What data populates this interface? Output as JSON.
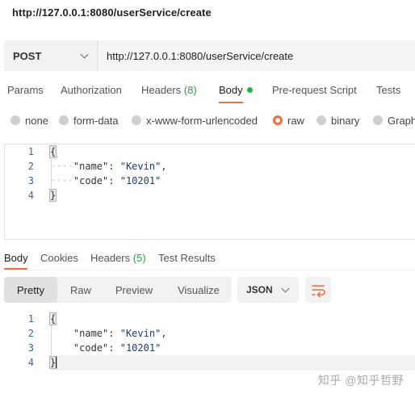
{
  "request": {
    "title": "http://127.0.0.1:8080/userService/create",
    "method": "POST",
    "url": "http://127.0.0.1:8080/userService/create"
  },
  "request_tabs": [
    {
      "label": "Params"
    },
    {
      "label": "Authorization"
    },
    {
      "label": "Headers",
      "badge": "(8)"
    },
    {
      "label": "Body",
      "active": true
    },
    {
      "label": "Pre-request Script"
    },
    {
      "label": "Tests"
    }
  ],
  "body_types": [
    {
      "label": "none"
    },
    {
      "label": "form-data"
    },
    {
      "label": "x-www-form-urlencoded"
    },
    {
      "label": "raw",
      "selected": true
    },
    {
      "label": "binary"
    },
    {
      "label": "Graph"
    }
  ],
  "request_body": {
    "line_numbers": [
      "1",
      "2",
      "3",
      "4"
    ],
    "open_brace": "{",
    "close_brace": "}",
    "fields": [
      {
        "key": "\"name\"",
        "value": "\"Kevin\"",
        "trail": ","
      },
      {
        "key": "\"code\"",
        "value": "\"10201\"",
        "trail": ""
      }
    ]
  },
  "response_tabs": [
    {
      "label": "Body",
      "active": true
    },
    {
      "label": "Cookies"
    },
    {
      "label": "Headers",
      "badge": "(5)"
    },
    {
      "label": "Test Results"
    }
  ],
  "view_modes": [
    {
      "label": "Pretty",
      "active": true
    },
    {
      "label": "Raw"
    },
    {
      "label": "Preview"
    },
    {
      "label": "Visualize"
    }
  ],
  "format_select": {
    "value": "JSON"
  },
  "response_body": {
    "line_numbers": [
      "1",
      "2",
      "3",
      "4"
    ],
    "open_brace": "{",
    "close_brace": "}",
    "fields": [
      {
        "key": "\"name\"",
        "value": "\"Kevin\"",
        "trail": ","
      },
      {
        "key": "\"code\"",
        "value": "\"10201\"",
        "trail": ""
      }
    ]
  },
  "watermark": "知乎 @知乎哲野",
  "colors": {
    "accent": "#f26b3a",
    "status_dot": "#22b14c",
    "line_number": "#3a63a8"
  },
  "icons": {
    "method_dropdown": "chevron-down-icon",
    "wrap": "wrap-lines-icon"
  }
}
